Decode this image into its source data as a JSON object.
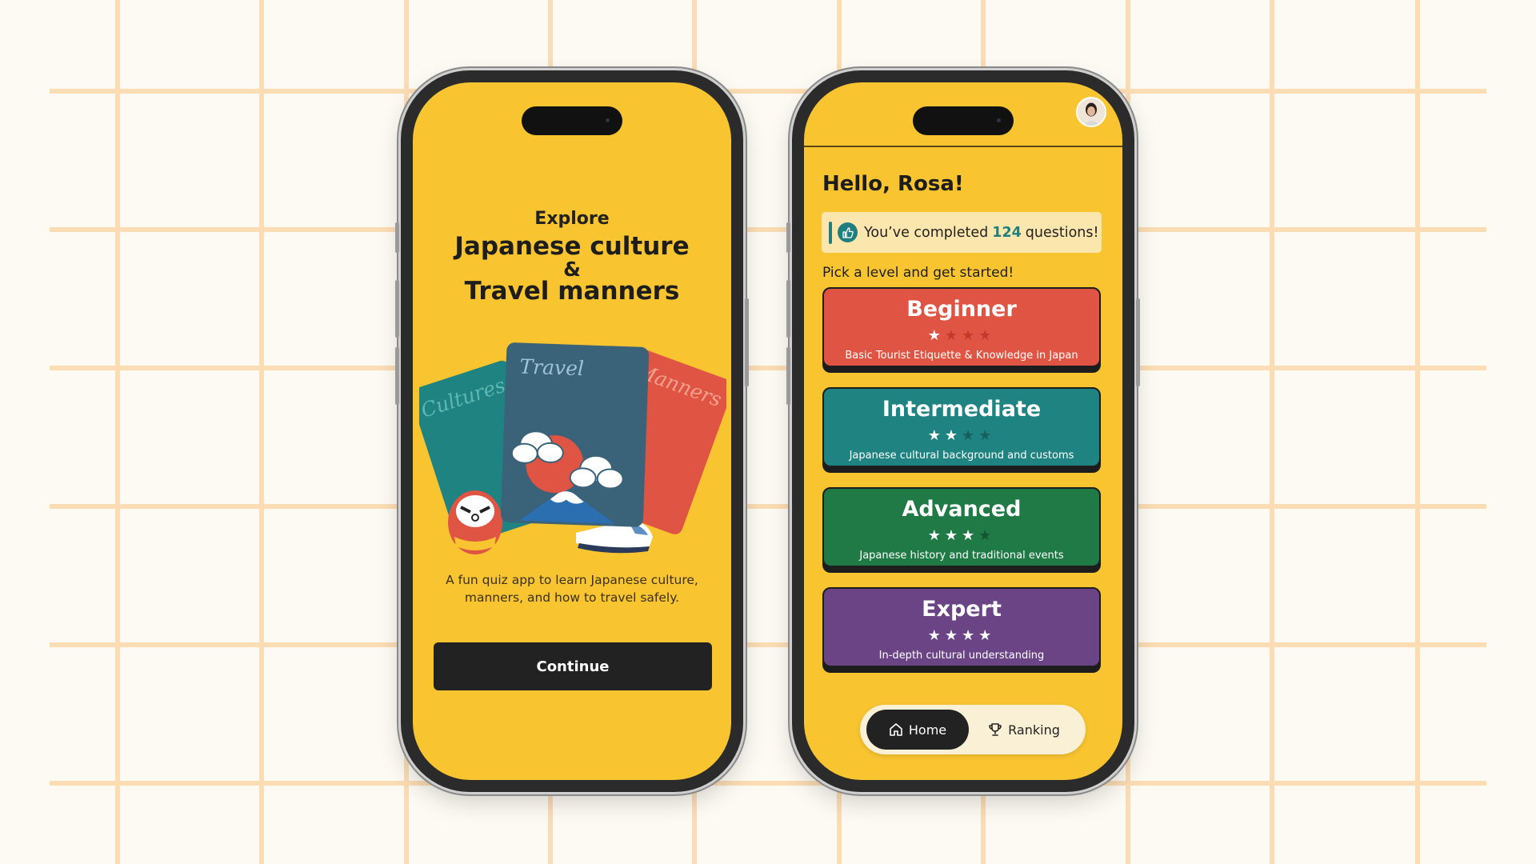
{
  "intro": {
    "explore": "Explore",
    "title_line1": "Japanese culture",
    "title_amp": "&",
    "title_line2": "Travel manners",
    "cards": [
      "Cultures",
      "Travel",
      "Manners"
    ],
    "description_line1": "A fun quiz app to learn Japanese culture,",
    "description_line2": "manners, and how to travel safely.",
    "continue_label": "Continue"
  },
  "home": {
    "greeting": "Hello, Rosa!",
    "completed_prefix": "You’ve completed",
    "completed_count": "124",
    "completed_suffix": "questions!",
    "pick_prompt": "Pick a level and get started!",
    "levels": [
      {
        "name": "Beginner",
        "stars": 1,
        "max_stars": 4,
        "description": "Basic Tourist Etiquette & Knowledge in Japan",
        "color": "#e05443",
        "star_off": "#c03b2e"
      },
      {
        "name": "Intermediate",
        "stars": 2,
        "max_stars": 4,
        "description": "Japanese cultural background and customs",
        "color": "#1f8381",
        "star_off": "#15605e"
      },
      {
        "name": "Advanced",
        "stars": 3,
        "max_stars": 4,
        "description": "Japanese history and traditional events",
        "color": "#1f7a45",
        "star_off": "#135530"
      },
      {
        "name": "Expert",
        "stars": 4,
        "max_stars": 4,
        "description": "In-depth cultural understanding",
        "color": "#6b4486",
        "star_off": "#4e2f63"
      }
    ],
    "tabs": {
      "home": "Home",
      "ranking": "Ranking"
    }
  },
  "colors": {
    "screen": "#f8c430",
    "grid_line": "#fbdcb3",
    "accent_teal": "#1f7f7e",
    "dark": "#222222"
  },
  "icons": {
    "home_tab": "house-icon",
    "ranking_tab": "trophy-icon",
    "completed": "thumbs-up-icon"
  }
}
